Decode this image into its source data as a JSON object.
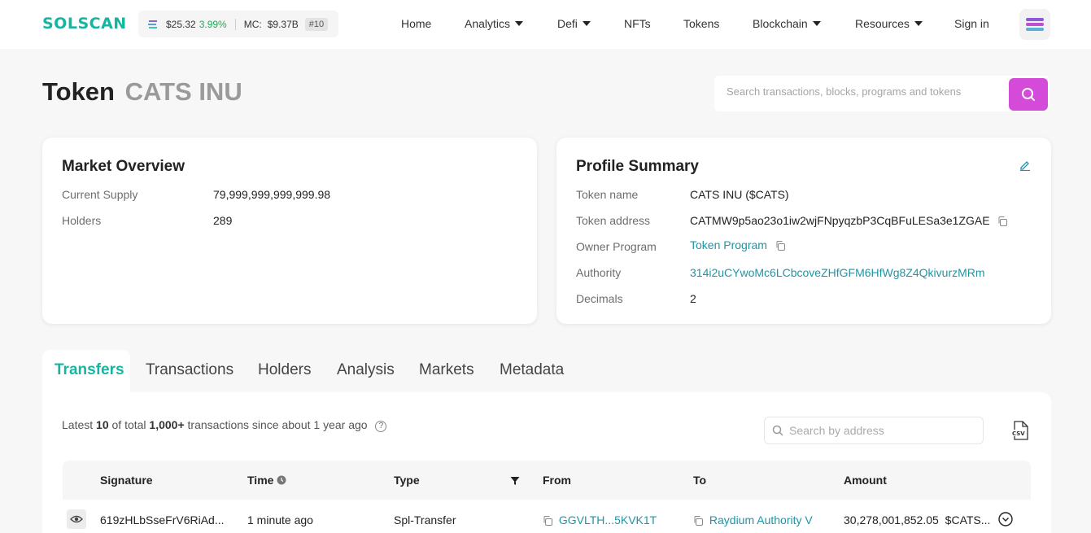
{
  "header": {
    "logo": "SOLSCAN",
    "price": "$25.32",
    "change": "3.99%",
    "mc_label": "MC:",
    "mc_value": "$9.37B",
    "rank": "#10",
    "nav": [
      {
        "label": "Home"
      },
      {
        "label": "Analytics"
      },
      {
        "label": "Defi"
      },
      {
        "label": "NFTs"
      },
      {
        "label": "Tokens"
      },
      {
        "label": "Blockchain"
      },
      {
        "label": "Resources"
      },
      {
        "label": "Sign in"
      }
    ]
  },
  "page": {
    "title": "Token",
    "subtitle": "CATS INU",
    "search_placeholder": "Search transactions, blocks, programs and tokens"
  },
  "market": {
    "title": "Market Overview",
    "rows": [
      {
        "label": "Current Supply",
        "value": "79,999,999,999,999.98"
      },
      {
        "label": "Holders",
        "value": "289"
      }
    ]
  },
  "profile": {
    "title": "Profile Summary",
    "rows": [
      {
        "label": "Token name",
        "value": "CATS INU ($CATS)"
      },
      {
        "label": "Token address",
        "value": "CATMW9p5ao23o1iw2wjFNpyqzbP3CqBFuLESa3e1ZGAE"
      },
      {
        "label": "Owner Program",
        "value": "Token Program"
      },
      {
        "label": "Authority",
        "value": "314i2uCYwoMc6LCbcoveZHfGFM6HfWg8Z4QkivurzMRm"
      },
      {
        "label": "Decimals",
        "value": "2"
      }
    ]
  },
  "tabs": [
    {
      "label": "Transfers"
    },
    {
      "label": "Transactions"
    },
    {
      "label": "Holders"
    },
    {
      "label": "Analysis"
    },
    {
      "label": "Markets"
    },
    {
      "label": "Metadata"
    }
  ],
  "transfers": {
    "summary_pre": "Latest",
    "summary_count": "10",
    "summary_mid": "of total",
    "summary_total": "1,000+",
    "summary_post": "transactions since about 1 year ago",
    "help": "?",
    "search_placeholder": "Search by address",
    "columns": [
      "Signature",
      "Time",
      "Type",
      "From",
      "To",
      "Amount"
    ],
    "rows": [
      {
        "signature": "619zHLbSseFrV6RiAd...",
        "time": "1 minute ago",
        "type": "Spl-Transfer",
        "from": "GGVLTH...5KVK1T",
        "to": "Raydium Authority V",
        "amount": "30,278,001,852.05",
        "symbol": "$CATS..."
      }
    ]
  },
  "colors": {
    "brand": "#16b5a1",
    "accent": "#d44ad9",
    "link": "#1e95a6",
    "up": "#26a65b"
  }
}
